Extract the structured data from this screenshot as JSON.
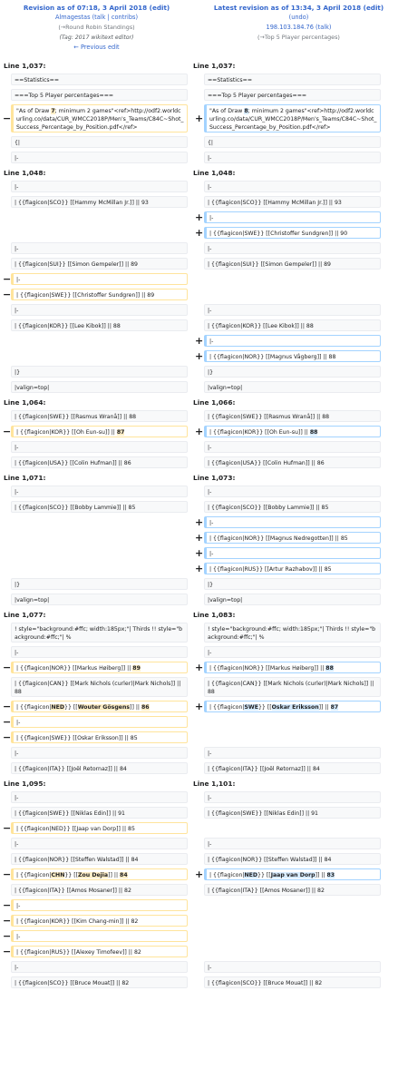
{
  "header": {
    "left": {
      "title": "Revision as of 07:18, 3 April 2018 (edit)",
      "user": "Almagestas (talk | contribs)",
      "summary": "(→Round Robin Standings)",
      "tag": "(Tag: 2017 wikitext editor)",
      "nav": "← Previous edit"
    },
    "right": {
      "title": "Latest revision as of 13:34, 3 April 2018 (edit)",
      "undo": "(undo)",
      "user": "198.103.184.76 (talk)",
      "summary": "(→Top 5 Player percentages)"
    }
  },
  "diff": {
    "rows": [
      {
        "type": "lineno",
        "left": "Line 1,037:",
        "right": "Line 1,037:"
      },
      {
        "type": "ctx",
        "text": "==Statistics=="
      },
      {
        "type": "ctx",
        "text": "===Top 5 Player percentages==="
      },
      {
        "type": "chg",
        "left_pre": "\"As of Draw ",
        "left_hl": "7",
        "left_post": "; minimum 2 games\"<ref>http://odf2.worldcurling.co/data/CUR_WMCC2018P/Men's_Teams/C84C~Shot_Success_Percentage_by_Position.pdf</ref>",
        "right_pre": "\"As of Draw ",
        "right_hl": "8",
        "right_post": "; minimum 2 games\"<ref>http://odf2.worldcurling.co/data/CUR_WMCC2018P/Men's_Teams/C84C~Shot_Success_Percentage_by_Position.pdf</ref>",
        "h": 3
      },
      {
        "type": "ctx",
        "text": "{|"
      },
      {
        "type": "ctx",
        "text": "|-"
      },
      {
        "type": "lineno",
        "left": "Line 1,048:",
        "right": "Line 1,048:"
      },
      {
        "type": "ctx",
        "text": "|-"
      },
      {
        "type": "ctx",
        "text": "| {{flagicon|SCO}} [[Hammy McMillan Jr.]] || 93"
      },
      {
        "type": "add",
        "text": "|-"
      },
      {
        "type": "add",
        "text": "| {{flagicon|SWE}} [[Christoffer Sundgren]] || 90"
      },
      {
        "type": "ctx",
        "text": "|-"
      },
      {
        "type": "ctx",
        "text": "| {{flagicon|SUI}} [[Simon Gempeler]] || 89"
      },
      {
        "type": "del",
        "text": "|-"
      },
      {
        "type": "del",
        "text": "| {{flagicon|SWE}} [[Christoffer Sundgren]] || 89"
      },
      {
        "type": "ctx",
        "text": "|-"
      },
      {
        "type": "ctx",
        "text": "| {{flagicon|KOR}} [[Lee Kibok]] || 88"
      },
      {
        "type": "add",
        "text": "|-"
      },
      {
        "type": "add",
        "text": "| {{flagicon|NOR}} [[Magnus Vågberg]] || 88"
      },
      {
        "type": "ctx",
        "text": "|}"
      },
      {
        "type": "ctx",
        "text": "|valign=top|"
      },
      {
        "type": "lineno",
        "left": "Line 1,064:",
        "right": "Line 1,066:"
      },
      {
        "type": "ctx",
        "text": "| {{flagicon|SWE}} [[Rasmus Wranå]] || 88"
      },
      {
        "type": "chg",
        "left_pre": "| {{flagicon|KOR}} [[Oh Eun-su]] || ",
        "left_hl": "87",
        "left_post": "",
        "right_pre": "| {{flagicon|KOR}} [[Oh Eun-su]] || ",
        "right_hl": "88",
        "right_post": "",
        "h": 1
      },
      {
        "type": "ctx",
        "text": "|-"
      },
      {
        "type": "ctx",
        "text": "| {{flagicon|USA}} [[Colin Hufman]] || 86"
      },
      {
        "type": "lineno",
        "left": "Line 1,071:",
        "right": "Line 1,073:"
      },
      {
        "type": "ctx",
        "text": "|-"
      },
      {
        "type": "ctx",
        "text": "| {{flagicon|SCO}} [[Bobby Lammie]] || 85"
      },
      {
        "type": "add",
        "text": "|-"
      },
      {
        "type": "add",
        "text": "| {{flagicon|NOR}} [[Magnus Nedregotten]] || 85"
      },
      {
        "type": "add",
        "text": "|-"
      },
      {
        "type": "add",
        "text": "| {{flagicon|RUS}} [[Artur Razhabov]] || 85"
      },
      {
        "type": "ctx",
        "text": "|}"
      },
      {
        "type": "ctx",
        "text": "|valign=top|"
      },
      {
        "type": "lineno",
        "left": "Line 1,077:",
        "right": "Line 1,083:"
      },
      {
        "type": "ctx",
        "text": "! style=\"background:#ffc; width:185px;\"| Thirds !! style=\"background:#ffc;\"| %",
        "h": 2
      },
      {
        "type": "ctx",
        "text": "|-"
      },
      {
        "type": "chg",
        "left_pre": "| {{flagicon|NOR}} [[Markus Høiberg]] || ",
        "left_hl": "89",
        "left_post": "",
        "right_pre": "| {{flagicon|NOR}} [[Markus Høiberg]] || ",
        "right_hl": "88",
        "right_post": "",
        "h": 1
      },
      {
        "type": "ctx",
        "text": "| {{flagicon|CAN}} [[Mark Nichols (curler)|Mark Nichols]] || 88",
        "h": 2
      },
      {
        "type": "chg3",
        "left_a": "| {{flagicon|",
        "left_b": "NED",
        "left_c": "}} [[",
        "left_d": "Wouter Gösgens",
        "left_e": "]] || ",
        "left_f": "86",
        "right_a": "| {{flagicon|",
        "right_b": "SWE",
        "right_c": "}} [[",
        "right_d": "Oskar Eriksson",
        "right_e": "]] || ",
        "right_f": "87",
        "h": 1
      },
      {
        "type": "del",
        "text": "|-"
      },
      {
        "type": "del",
        "text": "| {{flagicon|SWE}} [[Oskar Eriksson]] || 85"
      },
      {
        "type": "ctx",
        "text": "|-"
      },
      {
        "type": "ctx",
        "text": "| {{flagicon|ITA}} [[Joël Retornaz]] || 84"
      },
      {
        "type": "lineno",
        "left": "Line 1,095:",
        "right": "Line 1,101:"
      },
      {
        "type": "ctx",
        "text": "|-"
      },
      {
        "type": "ctx",
        "text": "| {{flagicon|SWE}} [[Niklas Edin]] || 91"
      },
      {
        "type": "del",
        "text": "| {{flagicon|NED}} [[Jaap van Dorp]] || 85"
      },
      {
        "type": "ctx",
        "text": "|-"
      },
      {
        "type": "ctx",
        "text": "| {{flagicon|NOR}} [[Steffen Walstad]] || 84"
      },
      {
        "type": "chg3",
        "left_a": "| {{flagicon|",
        "left_b": "CHN",
        "left_c": "}} [[",
        "left_d": "Zou Dejia",
        "left_e": "]] || ",
        "left_f": "84",
        "right_a": "| {{flagicon|",
        "right_b": "NED",
        "right_c": "}} [[",
        "right_d": "Jaap van Dorp",
        "right_e": "]] || ",
        "right_f": "83",
        "h": 1
      },
      {
        "type": "ctx",
        "text": "| {{flagicon|ITA}} [[Amos Mosaner]] || 82"
      },
      {
        "type": "del",
        "text": "|-"
      },
      {
        "type": "del",
        "text": "| {{flagicon|KOR}} [[Kim Chang-min]] || 82"
      },
      {
        "type": "del",
        "text": "|-"
      },
      {
        "type": "del",
        "text": "| {{flagicon|RUS}} [[Alexey Timofeev]] || 82"
      },
      {
        "type": "ctx",
        "text": "|-"
      },
      {
        "type": "ctx",
        "text": "| {{flagicon|SCO}} [[Bruce Mouat]] || 82"
      }
    ]
  }
}
